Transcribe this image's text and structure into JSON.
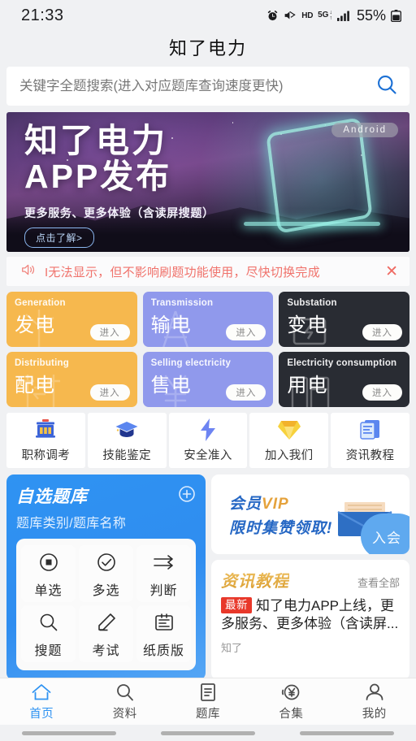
{
  "status_bar": {
    "time": "21:33",
    "battery_percent": "55%",
    "network_type": "5G",
    "hd_label": "HD",
    "icons": [
      "alarm-icon",
      "mute-icon",
      "hd-icon",
      "5g-icon",
      "signal-icon",
      "battery-icon"
    ]
  },
  "header": {
    "title": "知了电力"
  },
  "search": {
    "placeholder": "关键字全题搜索(进入对应题库查询速度更快)",
    "value": "",
    "icon": "search-icon"
  },
  "banner": {
    "line1": "知了电力",
    "line2": "APP发布",
    "subtitle": "更多服务、更多体验（含读屏搜题）",
    "button": "点击了解>",
    "badge": "Android"
  },
  "notice": {
    "text": "I无法显示，但不影响刷题功能使用，尽快切换完成",
    "icon": "speaker-icon",
    "close_icon": "close-icon",
    "color": "#f0736c"
  },
  "categories": [
    {
      "en": "Generation",
      "cn": "发电",
      "action": "进入",
      "theme": "orange",
      "color": "#f6b84e",
      "art": "windmill-icon"
    },
    {
      "en": "Transmission",
      "cn": "输电",
      "action": "进入",
      "theme": "purple",
      "color": "#9099ec",
      "art": "tower-icon"
    },
    {
      "en": "Substation",
      "cn": "变电",
      "action": "进入",
      "theme": "dark",
      "color": "#292c33",
      "art": "transformer-icon"
    },
    {
      "en": "Distributing",
      "cn": "配电",
      "action": "进入",
      "theme": "orange",
      "color": "#f6b84e",
      "art": "pole-icon"
    },
    {
      "en": "Selling electricity",
      "cn": "售电",
      "action": "进入",
      "theme": "purple",
      "color": "#9099ec",
      "art": "yuan-icon"
    },
    {
      "en": "Electricity consumption",
      "cn": "用电",
      "action": "进入",
      "theme": "dark",
      "color": "#292c33",
      "art": "appliance-icon"
    }
  ],
  "quick_links": [
    {
      "label": "职称调考",
      "icon": "building-icon"
    },
    {
      "label": "技能鉴定",
      "icon": "graduation-cap-icon"
    },
    {
      "label": "安全准入",
      "icon": "lightning-bolt-icon"
    },
    {
      "label": "加入我们",
      "icon": "diamond-icon"
    },
    {
      "label": "资讯教程",
      "icon": "document-icon"
    }
  ],
  "bank_card": {
    "title": "自选题库",
    "subtitle": "题库类别/题库名称",
    "add_icon": "plus-circle-icon",
    "items": [
      {
        "label": "单选",
        "icon": "radio-button-icon"
      },
      {
        "label": "多选",
        "icon": "check-circle-icon"
      },
      {
        "label": "判断",
        "icon": "arrows-icon"
      },
      {
        "label": "搜题",
        "icon": "search-icon"
      },
      {
        "label": "考试",
        "icon": "pencil-icon"
      },
      {
        "label": "纸质版",
        "icon": "paper-icon"
      }
    ]
  },
  "vip_card": {
    "line1_cn": "会员",
    "line1_en": "VIP",
    "line2": "限时集赞领取!",
    "join_button": "入会",
    "art_icon": "envelope-money-icon"
  },
  "news_card": {
    "title": "资讯教程",
    "view_all": "查看全部",
    "badge": "最新",
    "headline": "知了电力APP上线，更多服务、更多体验（含读屏...",
    "author": "知了"
  },
  "tabbar": [
    {
      "label": "首页",
      "icon": "home-icon",
      "active": true
    },
    {
      "label": "资料",
      "icon": "search-icon",
      "active": false
    },
    {
      "label": "题库",
      "icon": "list-document-icon",
      "active": false
    },
    {
      "label": "合集",
      "icon": "yen-coin-icon",
      "active": false
    },
    {
      "label": "我的",
      "icon": "person-icon",
      "active": false
    }
  ],
  "theme": {
    "accent": "#2f93f2",
    "orange": "#f6b84e",
    "purple": "#9099ec",
    "dark": "#292c33",
    "notice": "#f0736c"
  }
}
